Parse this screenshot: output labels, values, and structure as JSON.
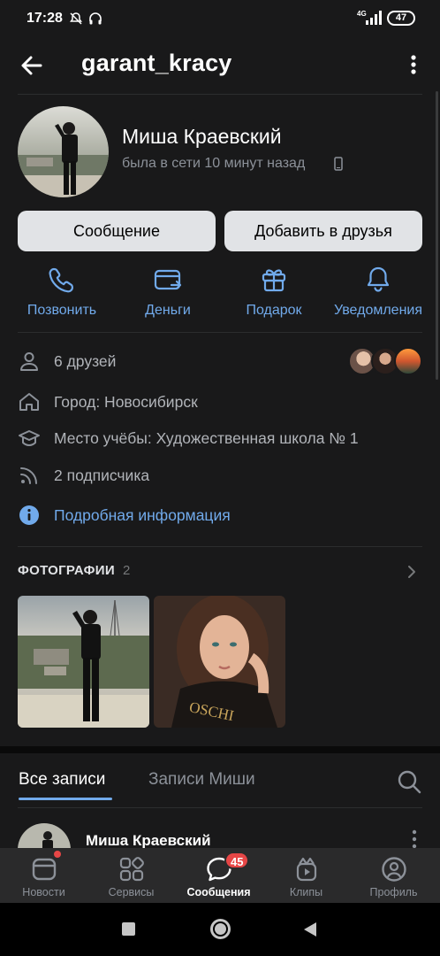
{
  "status_bar": {
    "time": "17:28",
    "network": "4G",
    "battery": "47"
  },
  "header": {
    "title": "garant_kracy"
  },
  "profile": {
    "name": "Миша Краевский",
    "online": "была в сети 10 минут назад"
  },
  "buttons": {
    "message": "Сообщение",
    "add_friend": "Добавить в друзья"
  },
  "actions": [
    {
      "label": "Позвонить",
      "icon": "phone-icon"
    },
    {
      "label": "Деньги",
      "icon": "money-icon"
    },
    {
      "label": "Подарок",
      "icon": "gift-icon"
    },
    {
      "label": "Уведомления",
      "icon": "bell-icon"
    }
  ],
  "info": {
    "friends": "6 друзей",
    "city": "Город: Новосибирск",
    "school": "Место учёбы: Художественная школа № 1",
    "followers": "2 подписчика",
    "more": "Подробная информация"
  },
  "photos": {
    "title": "ФОТОГРАФИИ",
    "count": "2"
  },
  "tabs": {
    "all": "Все записи",
    "misha": "Записи Миши"
  },
  "post": {
    "author": "Миша Краевский"
  },
  "bottom_nav": {
    "items": [
      {
        "label": "Новости",
        "icon": "news-icon"
      },
      {
        "label": "Сервисы",
        "icon": "services-icon"
      },
      {
        "label": "Сообщения",
        "icon": "messages-icon"
      },
      {
        "label": "Клипы",
        "icon": "clips-icon"
      },
      {
        "label": "Профиль",
        "icon": "profile-icon"
      }
    ],
    "badge": "45"
  },
  "colors": {
    "accent": "#71aaeb",
    "background": "#19191a",
    "badge": "#e64646",
    "button": "#e1e3e6"
  }
}
